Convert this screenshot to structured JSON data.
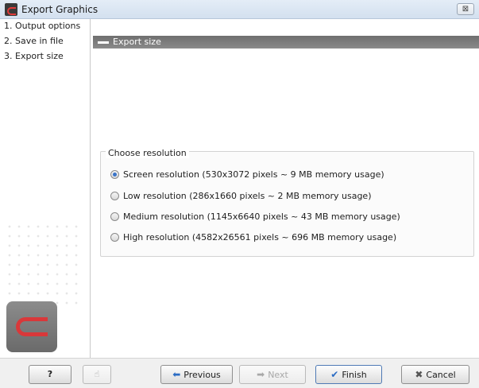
{
  "window": {
    "title": "Export Graphics",
    "close_glyph": "⊠"
  },
  "steps": [
    "1. Output options",
    "2. Save in file",
    "3. Export size"
  ],
  "section": {
    "title": "Export size"
  },
  "resolution": {
    "legend": "Choose resolution",
    "options": [
      {
        "label": "Screen resolution (530x3072 pixels ~ 9 MB memory usage)",
        "checked": true
      },
      {
        "label": "Low resolution (286x1660 pixels ~ 2 MB memory usage)",
        "checked": false
      },
      {
        "label": "Medium resolution (1145x6640 pixels ~ 43 MB memory usage)",
        "checked": false
      },
      {
        "label": "High resolution (4582x26561 pixels ~ 696 MB memory usage)",
        "checked": false
      }
    ]
  },
  "buttons": {
    "help": "?",
    "previous": "Previous",
    "next": "Next",
    "finish": "Finish",
    "cancel": "Cancel"
  },
  "icons": {
    "app": "clc-logo-icon",
    "close": "close-icon",
    "help": "question-icon",
    "pointer": "hand-pointer-icon",
    "previous": "arrow-left-icon",
    "next": "arrow-right-icon",
    "finish": "checkmark-icon",
    "cancel": "x-icon"
  },
  "colors": {
    "accent": "#2b6cc4",
    "brand": "#d9383a",
    "header": "#7a7a7a"
  }
}
